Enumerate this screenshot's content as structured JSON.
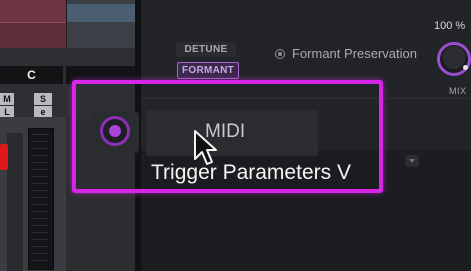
{
  "mixer": {
    "channel_name": "C",
    "mute_label": "M",
    "solo_label": "S",
    "listen_label": "L"
  },
  "plugin": {
    "detune_label": "DETUNE",
    "formant_label": "FORMANT",
    "formant_preservation_label": "Formant Preservation",
    "mix_value": "100 %",
    "mix_label": "MIX",
    "midi_label": "MIDI",
    "tooltip_text": "Trigger Parameters V"
  },
  "colors": {
    "highlight": "#d726e8",
    "accent_purple": "#a844d8",
    "fader_red": "#e01818"
  }
}
